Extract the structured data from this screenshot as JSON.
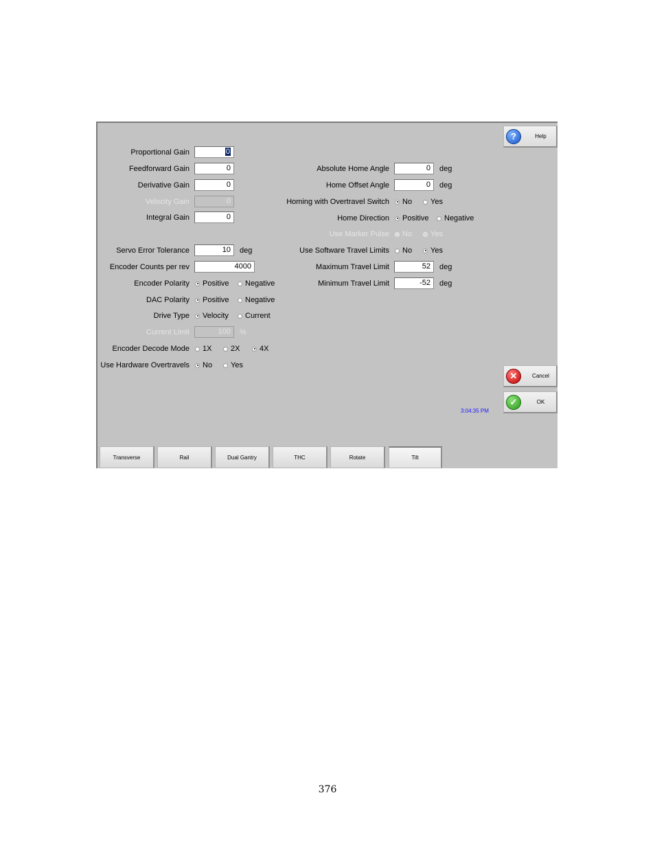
{
  "left_fields": [
    {
      "label": "Proportional Gain",
      "value": "0",
      "disabled": false,
      "selected": true
    },
    {
      "label": "Feedforward Gain",
      "value": "0",
      "disabled": false
    },
    {
      "label": "Derivative Gain",
      "value": "0",
      "disabled": false
    },
    {
      "label": "Velocity Gain",
      "value": "0",
      "disabled": true
    },
    {
      "label": "Integral Gain",
      "value": "0",
      "disabled": false
    }
  ],
  "servo_error": {
    "label": "Servo Error Tolerance",
    "value": "10",
    "unit": "deg"
  },
  "encoder_counts": {
    "label": "Encoder Counts per rev",
    "value": "4000"
  },
  "encoder_polarity": {
    "label": "Encoder Polarity",
    "options": [
      "Positive",
      "Negative"
    ],
    "selected": "Positive"
  },
  "dac_polarity": {
    "label": "DAC Polarity",
    "options": [
      "Positive",
      "Negative"
    ],
    "selected": "Positive"
  },
  "drive_type": {
    "label": "Drive Type",
    "options": [
      "Velocity",
      "Current"
    ],
    "selected": "Velocity"
  },
  "current_limit": {
    "label": "Current Limit",
    "value": "100",
    "unit": "%",
    "disabled": true
  },
  "encoder_decode": {
    "label": "Encoder Decode Mode",
    "options": [
      "1X",
      "2X",
      "4X"
    ],
    "selected": "4X"
  },
  "hw_overtravels": {
    "label": "Use Hardware Overtravels",
    "options": [
      "No",
      "Yes"
    ],
    "selected": "No"
  },
  "abs_home_angle": {
    "label": "Absolute Home Angle",
    "value": "0",
    "unit": "deg"
  },
  "home_offset_angle": {
    "label": "Home Offset Angle",
    "value": "0",
    "unit": "deg"
  },
  "homing_overtravel": {
    "label": "Homing with Overtravel Switch",
    "options": [
      "No",
      "Yes"
    ],
    "selected": "No"
  },
  "home_direction": {
    "label": "Home Direction",
    "options": [
      "Positive",
      "Negative"
    ],
    "selected": "Positive"
  },
  "marker_pulse": {
    "label": "Use Marker Pulse",
    "options": [
      "No",
      "Yes"
    ],
    "selected": "No",
    "disabled": true
  },
  "sw_travel_limits": {
    "label": "Use Software Travel Limits",
    "options": [
      "No",
      "Yes"
    ],
    "selected": "Yes"
  },
  "max_travel": {
    "label": "Maximum Travel Limit",
    "value": "52",
    "unit": "deg"
  },
  "min_travel": {
    "label": "Minimum Travel Limit",
    "value": "-52",
    "unit": "deg"
  },
  "buttons": {
    "help": "Help",
    "cancel": "Cancel",
    "ok": "OK"
  },
  "clock": "3:04:35 PM",
  "tabs": [
    {
      "label": "Transverse",
      "active": false
    },
    {
      "label": "Rail",
      "active": false
    },
    {
      "label": "Dual Gantry",
      "active": false
    },
    {
      "label": "THC",
      "active": false
    },
    {
      "label": "Rotate",
      "active": false
    },
    {
      "label": "Tilt",
      "active": true
    }
  ],
  "page_number": "376"
}
